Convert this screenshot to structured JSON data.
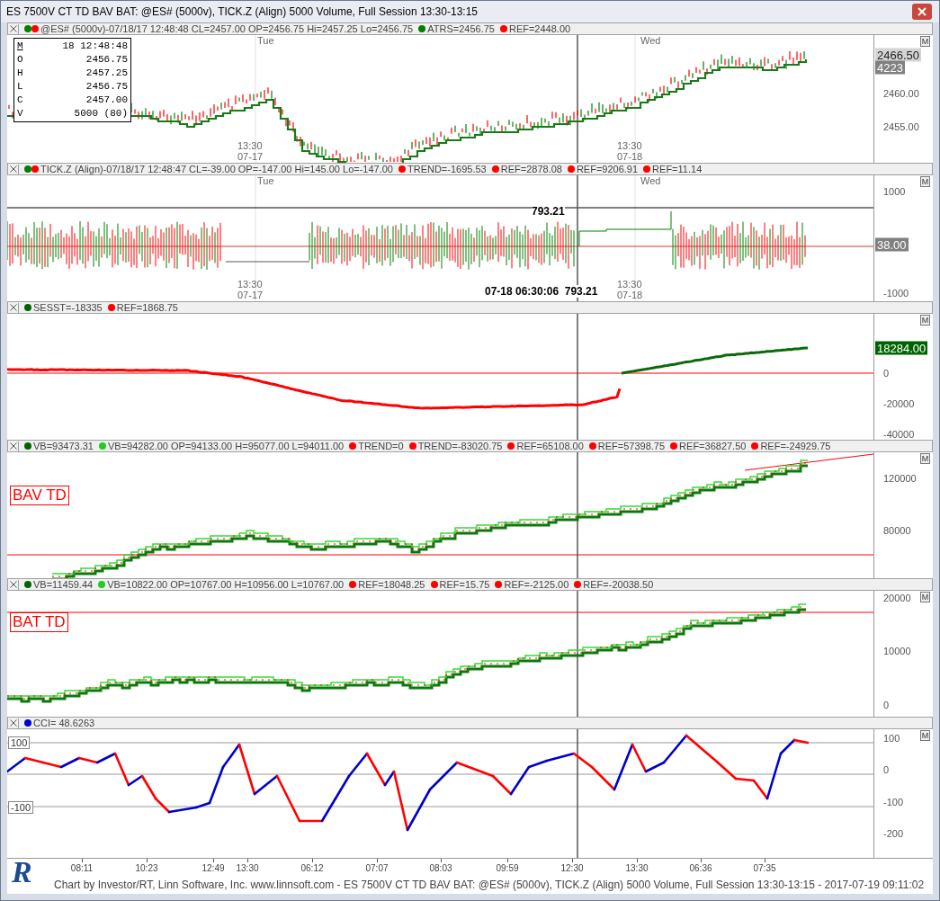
{
  "window": {
    "title": "ES 7500V CT TD BAV BAT: @ES# (5000v), TICK.Z (Align) 5000 Volume, Full Session 13:30-13:15"
  },
  "panels": [
    {
      "kind": "price",
      "menu_button": "M",
      "legend": [
        {
          "text": "@ES# (5000v)-07/18/17 12:48:48 CL=2457.00 OP=2456.75 Hi=2457.25 Lo=2456.75",
          "dots": [
            {
              "color": "#008000"
            },
            {
              "color": "#ff0000"
            }
          ]
        },
        {
          "text": "ATRS=2456.75",
          "dots": [
            {
              "color": "#008000"
            }
          ]
        },
        {
          "text": "REF=2448.00",
          "dots": [
            {
              "color": "#ff0000"
            }
          ]
        }
      ],
      "axis_labels": [
        {
          "text": "2466.50",
          "kind": "badge",
          "color": "#d4d4d4"
        },
        {
          "text": "4223",
          "kind": "badge",
          "color": "#808080"
        },
        {
          "text": "2460.00",
          "kind": "plain"
        },
        {
          "text": "2455.00",
          "kind": "plain"
        }
      ],
      "time_markers": [
        "Tue",
        "Wed"
      ],
      "session_labels": [
        {
          "time": "13:30",
          "date": "07-17"
        },
        {
          "time": "13:30",
          "date": "07-18"
        }
      ],
      "ohlc_box": [
        {
          "label": "M",
          "value": "18 12:48:48"
        },
        {
          "label": "O",
          "value": "2456.75"
        },
        {
          "label": "H",
          "value": "2457.25"
        },
        {
          "label": "L",
          "value": "2456.75"
        },
        {
          "label": "C",
          "value": "2457.00"
        },
        {
          "label": "V",
          "value": "5000 (80)"
        }
      ]
    },
    {
      "kind": "tick",
      "menu_button": "M",
      "legend": [
        {
          "text": "TICK.Z (Align)-07/18/17 12:48:47 CL=-39.00 OP=-147.00 Hi=145.00 Lo=-147.00",
          "dots": [
            {
              "color": "#008000"
            },
            {
              "color": "#ff0000"
            }
          ]
        },
        {
          "text": "TREND=-1695.53",
          "dots": [
            {
              "color": "#ff0000"
            }
          ]
        },
        {
          "text": "REF=2878.08",
          "dots": [
            {
              "color": "#ff0000"
            }
          ]
        },
        {
          "text": "REF=9206.91",
          "dots": [
            {
              "color": "#ff0000"
            }
          ]
        },
        {
          "text": "REF=11.14",
          "dots": [
            {
              "color": "#ff0000"
            }
          ]
        }
      ],
      "axis_labels": [
        {
          "text": "1000",
          "kind": "plain"
        },
        {
          "text": "38.00",
          "kind": "badge",
          "color": "#808080"
        },
        {
          "text": "-1000",
          "kind": "plain"
        }
      ],
      "time_markers": [
        "Tue",
        "Wed"
      ],
      "session_labels": [
        {
          "time": "13:30",
          "date": "07-17"
        },
        {
          "time": "13:30",
          "date": "07-18"
        }
      ],
      "annotations": [
        "793.21",
        "07-18 06:30:06  793.21"
      ]
    },
    {
      "kind": "line",
      "menu_button": "M",
      "legend": [
        {
          "text": "SESST=-18335",
          "dots": [
            {
              "color": "#006400"
            }
          ]
        },
        {
          "text": "REF=1868.75",
          "dots": [
            {
              "color": "#ff0000"
            }
          ]
        }
      ],
      "axis_labels": [
        {
          "text": "18284.00",
          "kind": "badge",
          "color": "#006400"
        },
        {
          "text": "0",
          "kind": "plain"
        },
        {
          "text": "-20000",
          "kind": "plain"
        },
        {
          "text": "-40000",
          "kind": "plain"
        }
      ]
    },
    {
      "kind": "bav",
      "menu_button": "M",
      "label_box": "BAV TD",
      "legend": [
        {
          "text": "VB=93473.31",
          "dots": [
            {
              "color": "#006400"
            }
          ]
        },
        {
          "text": "VB=94282.00 OP=94133.00 H=95077.00 L=94011.00",
          "dots": [
            {
              "color": "#22cc22"
            }
          ]
        },
        {
          "text": "TREND=0",
          "dots": [
            {
              "color": "#ff0000"
            }
          ]
        },
        {
          "text": "TREND=-83020.75",
          "dots": [
            {
              "color": "#ff0000"
            }
          ]
        },
        {
          "text": "REF=65108.00",
          "dots": [
            {
              "color": "#ff0000"
            }
          ]
        },
        {
          "text": "REF=57398.75",
          "dots": [
            {
              "color": "#ff0000"
            }
          ]
        },
        {
          "text": "REF=36827.50",
          "dots": [
            {
              "color": "#ff0000"
            }
          ]
        },
        {
          "text": "REF=-24929.75",
          "dots": [
            {
              "color": "#ff0000"
            }
          ]
        }
      ],
      "axis_labels": [
        {
          "text": "120000",
          "kind": "plain"
        },
        {
          "text": "80000",
          "kind": "plain"
        }
      ]
    },
    {
      "kind": "bat",
      "menu_button": "M",
      "label_box": "BAT TD",
      "legend": [
        {
          "text": "VB=11459.44",
          "dots": [
            {
              "color": "#006400"
            }
          ]
        },
        {
          "text": "VB=10822.00 OP=10767.00 H=10956.00 L=10767.00",
          "dots": [
            {
              "color": "#22cc22"
            }
          ]
        },
        {
          "text": "REF=18048.25",
          "dots": [
            {
              "color": "#ff0000"
            }
          ]
        },
        {
          "text": "REF=15.75",
          "dots": [
            {
              "color": "#ff0000"
            }
          ]
        },
        {
          "text": "REF=-2125.00",
          "dots": [
            {
              "color": "#ff0000"
            }
          ]
        },
        {
          "text": "REF=-20038.50",
          "dots": [
            {
              "color": "#ff0000"
            }
          ]
        }
      ],
      "axis_labels": [
        {
          "text": "20000",
          "kind": "plain"
        },
        {
          "text": "10000",
          "kind": "plain"
        },
        {
          "text": "0",
          "kind": "plain"
        }
      ]
    },
    {
      "kind": "oscillator",
      "menu_button": "M",
      "legend": [
        {
          "text": "CCI= 48.6263",
          "dots": [
            {
              "color": "#0000cc"
            }
          ]
        }
      ],
      "left_labels": [
        "100",
        "-100"
      ],
      "axis_labels": [
        {
          "text": "100",
          "kind": "plain"
        },
        {
          "text": "0",
          "kind": "plain"
        },
        {
          "text": "-100",
          "kind": "plain"
        },
        {
          "text": "-200",
          "kind": "plain"
        }
      ]
    }
  ],
  "time_axis": [
    "08:11",
    "10:23",
    "12:49",
    "13:30",
    "06:12",
    "07:07",
    "08:03",
    "09:59",
    "12:30",
    "13:30",
    "06:36",
    "07:35"
  ],
  "footer": {
    "logo": "R",
    "text": "Chart by Investor/RT, Linn Software, Inc. www.linnsoft.com - ES 7500V CT TD BAV BAT: @ES# (5000v), TICK.Z (Align) 5000 Volume, Full Session 13:30-13:15 - 2017-07-19 09:11:02"
  }
}
